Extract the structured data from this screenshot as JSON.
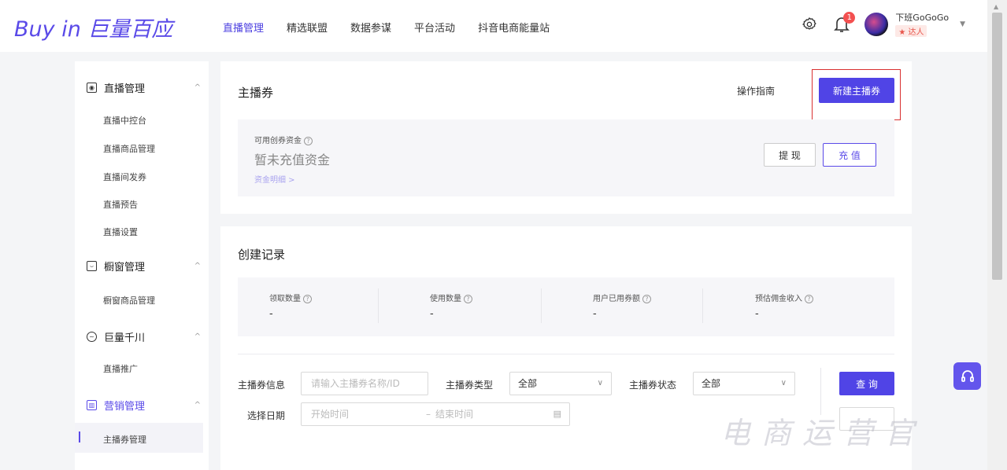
{
  "logo": {
    "prefix": "Buy in",
    "brand": "巨量百应"
  },
  "nav": [
    "直播管理",
    "精选联盟",
    "数据参谋",
    "平台活动",
    "抖音电商能量站"
  ],
  "notifications": {
    "count": "1"
  },
  "user": {
    "name": "下班GoGoGo",
    "tag": "★ 达人"
  },
  "sidebar": {
    "groups": [
      {
        "label": "直播管理",
        "items": [
          "直播中控台",
          "直播商品管理",
          "直播间发券",
          "直播预告",
          "直播设置"
        ]
      },
      {
        "label": "橱窗管理",
        "items": [
          "橱窗商品管理"
        ]
      },
      {
        "label": "巨量千川",
        "items": [
          "直播推广"
        ]
      },
      {
        "label": "营销管理",
        "items": [
          "主播券管理"
        ]
      }
    ]
  },
  "coupon": {
    "title": "主播券",
    "guide": "操作指南",
    "new_button": "新建主播券",
    "fund_label": "可用创券资金",
    "fund_value": "暂未充值资金",
    "fund_link": "资金明细 >",
    "withdraw": "提 现",
    "recharge": "充 值"
  },
  "records": {
    "title": "创建记录",
    "stats": [
      {
        "label": "领取数量",
        "value": "-"
      },
      {
        "label": "使用数量",
        "value": "-"
      },
      {
        "label": "用户已用券额",
        "value": "-"
      },
      {
        "label": "预估佣金收入",
        "value": "-"
      }
    ]
  },
  "filters": {
    "info_label": "主播券信息",
    "info_placeholder": "请输入主播券名称/ID",
    "type_label": "主播券类型",
    "type_value": "全部",
    "status_label": "主播券状态",
    "status_value": "全部",
    "date_label": "选择日期",
    "date_start": "开始时间",
    "date_sep": "–",
    "date_end": "结束时间",
    "query": "查 询"
  },
  "watermark": "电商运营官"
}
